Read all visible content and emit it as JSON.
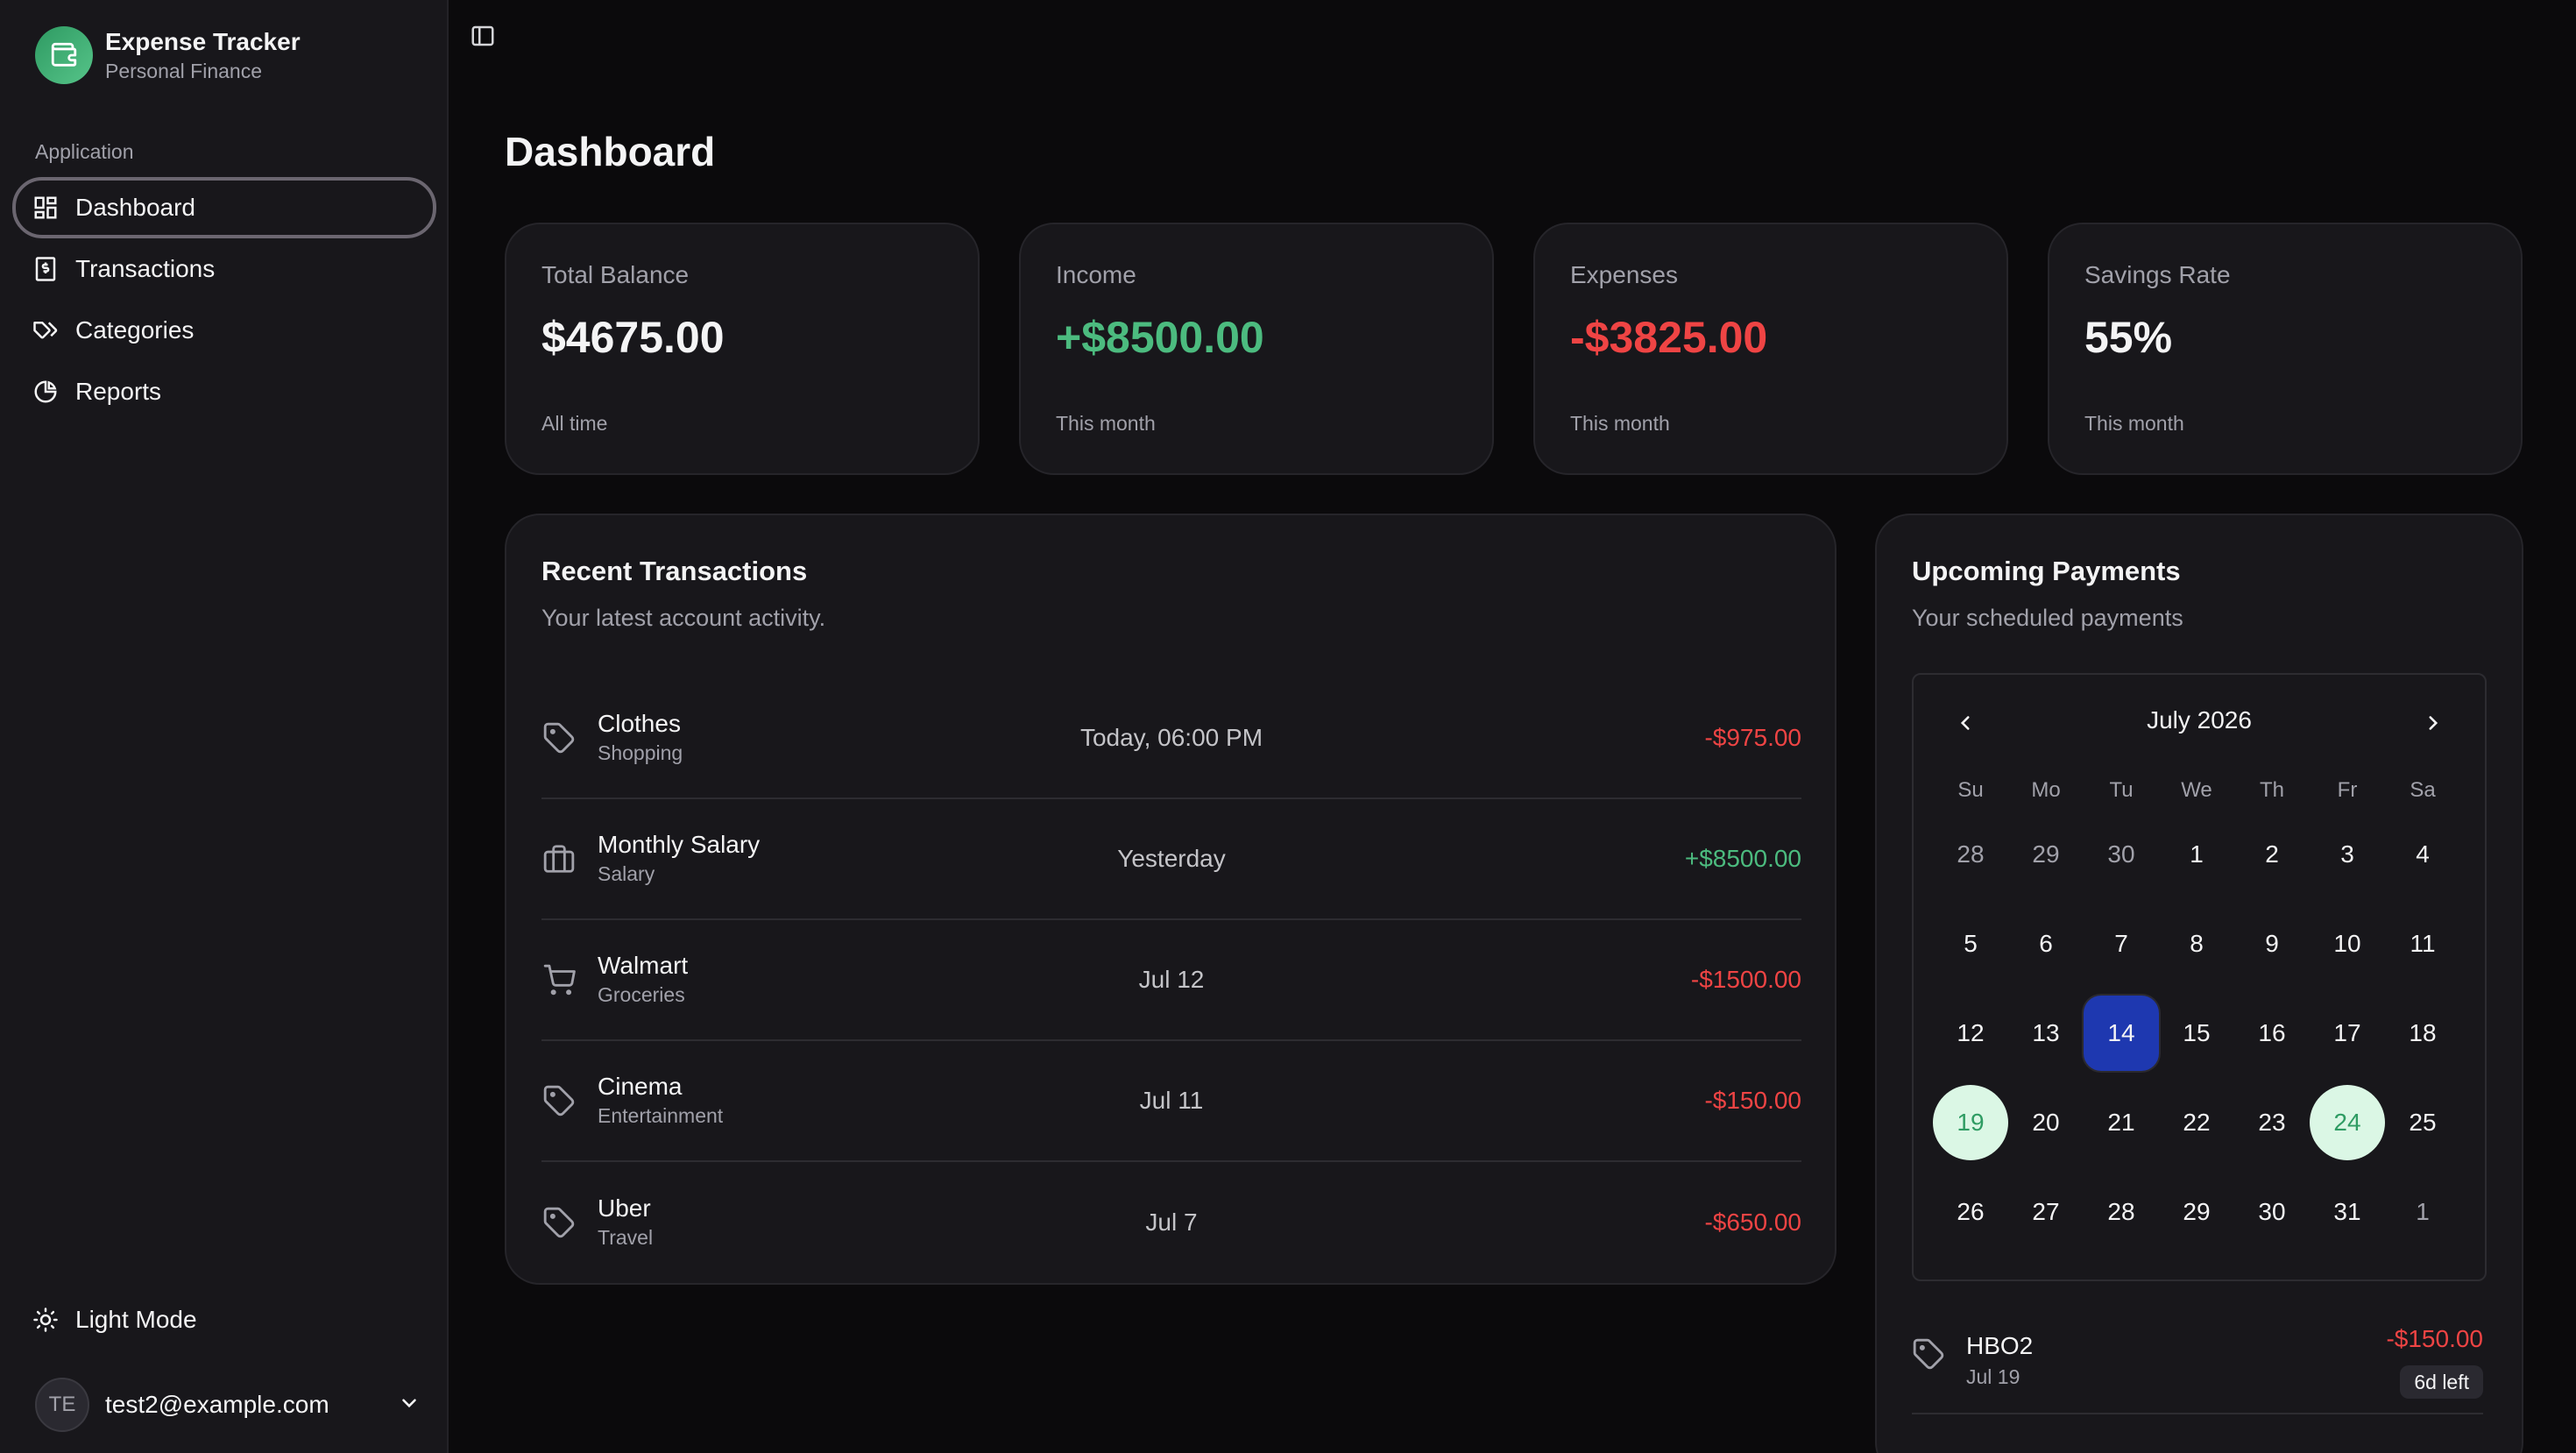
{
  "brand": {
    "title": "Expense Tracker",
    "subtitle": "Personal Finance",
    "icon": "wallet-icon"
  },
  "sidebar": {
    "group_label": "Application",
    "items": [
      {
        "label": "Dashboard",
        "icon": "layout-grid-icon",
        "active": true
      },
      {
        "label": "Transactions",
        "icon": "receipt-dollar-icon",
        "active": false
      },
      {
        "label": "Categories",
        "icon": "tags-icon",
        "active": false
      },
      {
        "label": "Reports",
        "icon": "pie-chart-icon",
        "active": false
      }
    ],
    "mode_label": "Light Mode",
    "user": {
      "initials": "TE",
      "email": "test2@example.com"
    }
  },
  "page": {
    "title": "Dashboard"
  },
  "stats": [
    {
      "label": "Total Balance",
      "value": "$4675.00",
      "foot": "All time",
      "tone": "default"
    },
    {
      "label": "Income",
      "value": "+$8500.00",
      "foot": "This month",
      "tone": "positive"
    },
    {
      "label": "Expenses",
      "value": "-$3825.00",
      "foot": "This month",
      "tone": "negative"
    },
    {
      "label": "Savings Rate",
      "value": "55%",
      "foot": "This month",
      "tone": "default"
    }
  ],
  "recent": {
    "title": "Recent Transactions",
    "description": "Your latest account activity.",
    "rows": [
      {
        "name": "Clothes",
        "category": "Shopping",
        "date": "Today, 06:00 PM",
        "amount": "-$975.00",
        "icon": "tag-icon",
        "tone": "negative"
      },
      {
        "name": "Monthly Salary",
        "category": "Salary",
        "date": "Yesterday",
        "amount": "+$8500.00",
        "icon": "briefcase-icon",
        "tone": "positive"
      },
      {
        "name": "Walmart",
        "category": "Groceries",
        "date": "Jul 12",
        "amount": "-$1500.00",
        "icon": "shopping-cart-icon",
        "tone": "negative"
      },
      {
        "name": "Cinema",
        "category": "Entertainment",
        "date": "Jul 11",
        "amount": "-$150.00",
        "icon": "tag-icon",
        "tone": "negative"
      },
      {
        "name": "Uber",
        "category": "Travel",
        "date": "Jul 7",
        "amount": "-$650.00",
        "icon": "tag-icon",
        "tone": "negative"
      }
    ]
  },
  "upcoming": {
    "title": "Upcoming Payments",
    "description": "Your scheduled payments",
    "calendar": {
      "month_label": "July 2026",
      "weekdays": [
        "Su",
        "Mo",
        "Tu",
        "We",
        "Th",
        "Fr",
        "Sa"
      ],
      "weeks": [
        [
          "28",
          "29",
          "30",
          "1",
          "2",
          "3",
          "4"
        ],
        [
          "5",
          "6",
          "7",
          "8",
          "9",
          "10",
          "11"
        ],
        [
          "12",
          "13",
          "14",
          "15",
          "16",
          "17",
          "18"
        ],
        [
          "19",
          "20",
          "21",
          "22",
          "23",
          "24",
          "25"
        ],
        [
          "26",
          "27",
          "28",
          "29",
          "30",
          "31",
          "1"
        ]
      ],
      "today": "14",
      "due_days": [
        "19",
        "24"
      ]
    },
    "payments": [
      {
        "name": "HBO2",
        "date": "Jul 19",
        "amount": "-$150.00",
        "badge": "6d left",
        "icon": "tag-icon"
      }
    ]
  },
  "colors": {
    "positive": "#4cbb7f",
    "negative": "#ef4444",
    "today": "#1e38b0",
    "due_bg": "#dbf7e5"
  }
}
